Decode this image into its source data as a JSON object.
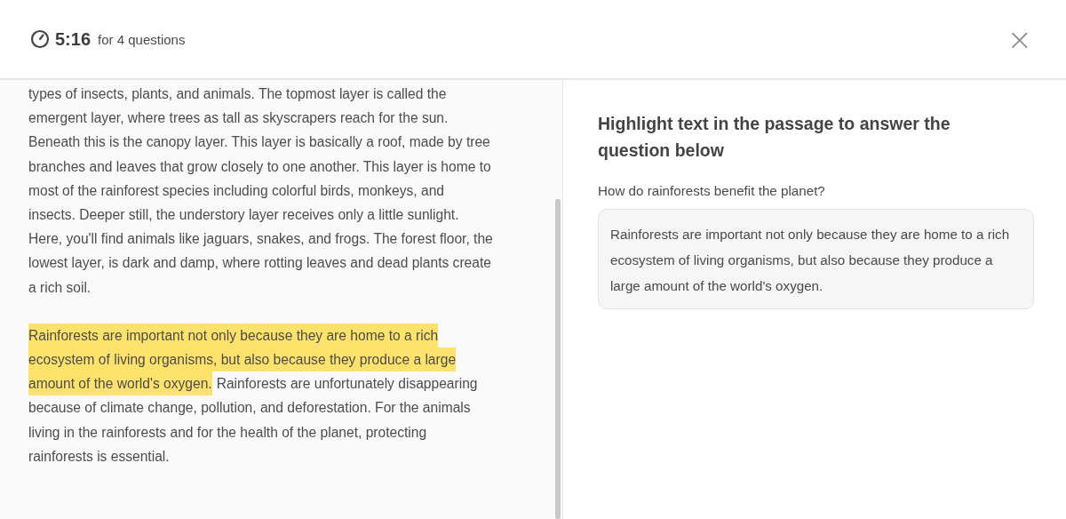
{
  "header": {
    "timer": "5:16",
    "timer_note": "for 4 questions",
    "close": "×"
  },
  "passage": {
    "paragraphs": [
      {
        "lines": [
          [
            {
              "text": "types of insects, plants, and animals. The topmost layer is called the",
              "highlighted": false
            }
          ],
          [
            {
              "text": "emergent layer, where trees as tall as skyscrapers reach for the sun.",
              "highlighted": false
            }
          ],
          [
            {
              "text": "Beneath this is the canopy layer. This layer is basically a roof, made by tree",
              "highlighted": false
            }
          ],
          [
            {
              "text": "branches and leaves that grow closely to one another. This layer is home to",
              "highlighted": false
            }
          ],
          [
            {
              "text": "most of the rainforest species including colorful birds, monkeys, and",
              "highlighted": false
            }
          ],
          [
            {
              "text": "insects. Deeper still, the understory layer receives only a little sunlight.",
              "highlighted": false
            }
          ],
          [
            {
              "text": "Here, you'll find animals like jaguars, snakes, and frogs. The forest floor, the",
              "highlighted": false
            }
          ],
          [
            {
              "text": "lowest layer, is dark and damp, where rotting leaves and dead plants create",
              "highlighted": false
            }
          ],
          [
            {
              "text": "a rich soil.",
              "highlighted": false
            }
          ]
        ]
      },
      {
        "lines": [
          [
            {
              "text": "Rainforests are important not only because they are home to a rich",
              "highlighted": true
            }
          ],
          [
            {
              "text": "ecosystem of living organisms, but also because they produce a large",
              "highlighted": true
            }
          ],
          [
            {
              "text": "amount of the world's oxygen.",
              "highlighted": true
            },
            {
              "text": "Rainforests are unfortunately disappearing",
              "highlighted": false
            }
          ],
          [
            {
              "text": "because of climate change, pollution, and deforestation. For the animals",
              "highlighted": false
            }
          ],
          [
            {
              "text": "living in the rainforests and for the health of the planet, protecting",
              "highlighted": false
            }
          ],
          [
            {
              "text": "rainforests is essential.",
              "highlighted": false
            }
          ]
        ]
      }
    ]
  },
  "question": {
    "instruction": "Highlight text in the passage to answer the question below",
    "prompt": "How do rainforests benefit the planet?",
    "answer": "Rainforests are important not only because they are home to a rich ecosystem of living organisms, but also because they produce a large amount of the world's oxygen."
  }
}
